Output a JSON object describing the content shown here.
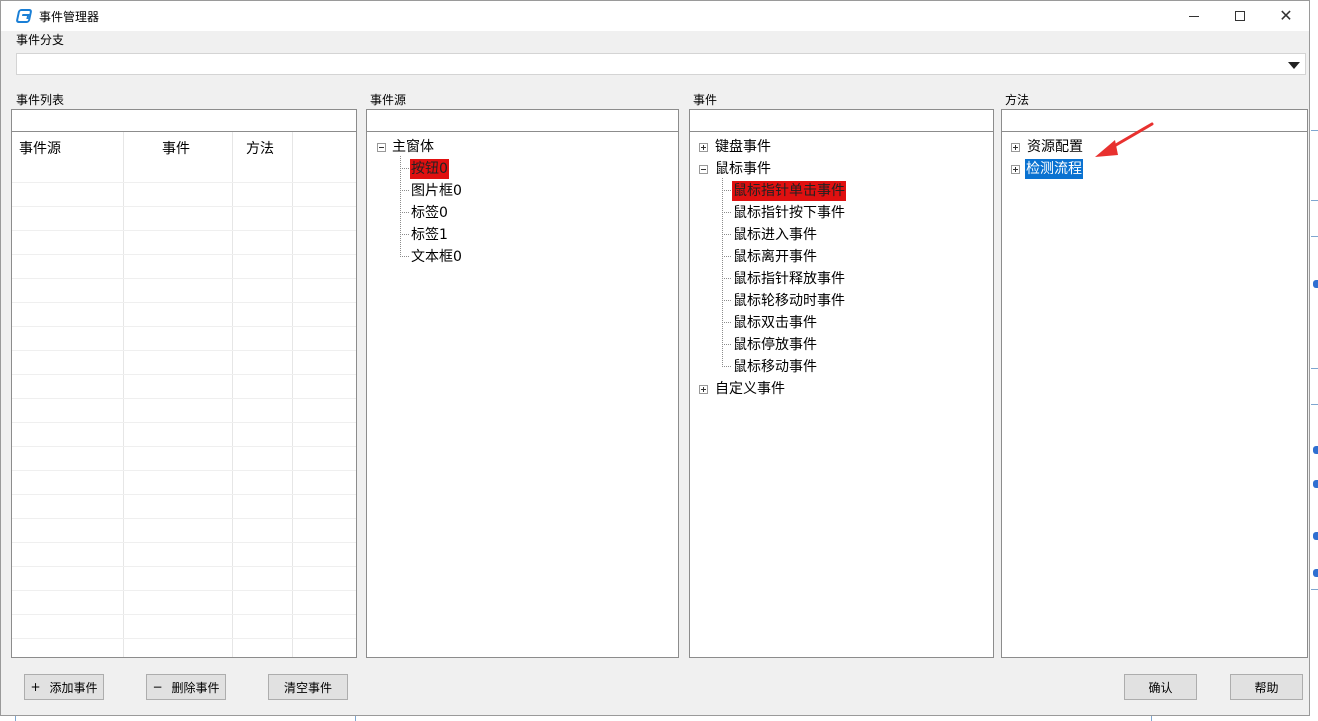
{
  "window": {
    "title": "事件管理器",
    "minimize_glyph": "—",
    "maximize_glyph": "☐",
    "close_glyph": "✕"
  },
  "branch": {
    "label": "事件分支",
    "value": ""
  },
  "event_list": {
    "label": "事件列表",
    "filter_value": "",
    "columns": [
      "事件源",
      "事件",
      "方法"
    ],
    "rows": []
  },
  "source": {
    "label": "事件源",
    "filter_value": "",
    "root": "主窗体",
    "children": [
      "按钮0",
      "图片框0",
      "标签0",
      "标签1",
      "文本框0"
    ],
    "selected": "按钮0"
  },
  "events": {
    "label": "事件",
    "filter_value": "",
    "keyboard": "键盘事件",
    "mouse": "鼠标事件",
    "mouse_children": [
      "鼠标指针单击事件",
      "鼠标指针按下事件",
      "鼠标进入事件",
      "鼠标离开事件",
      "鼠标指针释放事件",
      "鼠标轮移动时事件",
      "鼠标双击事件",
      "鼠标停放事件",
      "鼠标移动事件"
    ],
    "custom": "自定义事件",
    "selected": "鼠标指针单击事件"
  },
  "methods": {
    "label": "方法",
    "filter_value": "",
    "items": [
      "资源配置",
      "检测流程"
    ],
    "selected": "检测流程",
    "annotation_color": "#e8312f"
  },
  "buttons": {
    "add": {
      "glyph": "+",
      "label": "添加事件"
    },
    "delete": {
      "glyph": "−",
      "label": "删除事件"
    },
    "clear": "清空事件",
    "confirm": "确认",
    "help": "帮助"
  },
  "colors": {
    "selection_red": "#e01010",
    "selection_blue": "#0a72d1",
    "window_bg": "#f0f0f0"
  }
}
